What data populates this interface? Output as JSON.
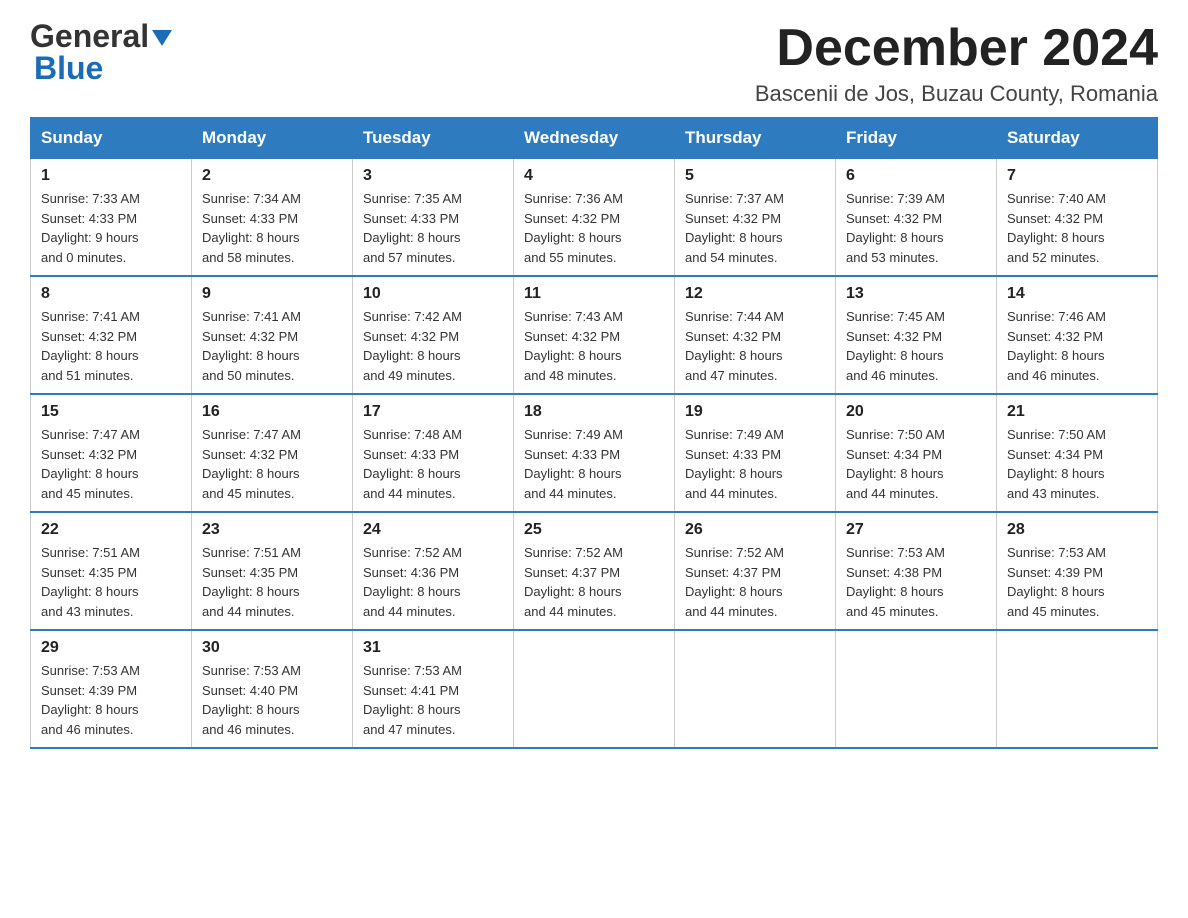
{
  "logo": {
    "general": "General",
    "blue": "Blue",
    "triangle": "▶"
  },
  "title": {
    "month_year": "December 2024",
    "location": "Bascenii de Jos, Buzau County, Romania"
  },
  "days_of_week": [
    "Sunday",
    "Monday",
    "Tuesday",
    "Wednesday",
    "Thursday",
    "Friday",
    "Saturday"
  ],
  "weeks": [
    [
      {
        "day": "1",
        "sunrise": "7:33 AM",
        "sunset": "4:33 PM",
        "daylight": "9 hours and 0 minutes."
      },
      {
        "day": "2",
        "sunrise": "7:34 AM",
        "sunset": "4:33 PM",
        "daylight": "8 hours and 58 minutes."
      },
      {
        "day": "3",
        "sunrise": "7:35 AM",
        "sunset": "4:33 PM",
        "daylight": "8 hours and 57 minutes."
      },
      {
        "day": "4",
        "sunrise": "7:36 AM",
        "sunset": "4:32 PM",
        "daylight": "8 hours and 55 minutes."
      },
      {
        "day": "5",
        "sunrise": "7:37 AM",
        "sunset": "4:32 PM",
        "daylight": "8 hours and 54 minutes."
      },
      {
        "day": "6",
        "sunrise": "7:39 AM",
        "sunset": "4:32 PM",
        "daylight": "8 hours and 53 minutes."
      },
      {
        "day": "7",
        "sunrise": "7:40 AM",
        "sunset": "4:32 PM",
        "daylight": "8 hours and 52 minutes."
      }
    ],
    [
      {
        "day": "8",
        "sunrise": "7:41 AM",
        "sunset": "4:32 PM",
        "daylight": "8 hours and 51 minutes."
      },
      {
        "day": "9",
        "sunrise": "7:41 AM",
        "sunset": "4:32 PM",
        "daylight": "8 hours and 50 minutes."
      },
      {
        "day": "10",
        "sunrise": "7:42 AM",
        "sunset": "4:32 PM",
        "daylight": "8 hours and 49 minutes."
      },
      {
        "day": "11",
        "sunrise": "7:43 AM",
        "sunset": "4:32 PM",
        "daylight": "8 hours and 48 minutes."
      },
      {
        "day": "12",
        "sunrise": "7:44 AM",
        "sunset": "4:32 PM",
        "daylight": "8 hours and 47 minutes."
      },
      {
        "day": "13",
        "sunrise": "7:45 AM",
        "sunset": "4:32 PM",
        "daylight": "8 hours and 46 minutes."
      },
      {
        "day": "14",
        "sunrise": "7:46 AM",
        "sunset": "4:32 PM",
        "daylight": "8 hours and 46 minutes."
      }
    ],
    [
      {
        "day": "15",
        "sunrise": "7:47 AM",
        "sunset": "4:32 PM",
        "daylight": "8 hours and 45 minutes."
      },
      {
        "day": "16",
        "sunrise": "7:47 AM",
        "sunset": "4:32 PM",
        "daylight": "8 hours and 45 minutes."
      },
      {
        "day": "17",
        "sunrise": "7:48 AM",
        "sunset": "4:33 PM",
        "daylight": "8 hours and 44 minutes."
      },
      {
        "day": "18",
        "sunrise": "7:49 AM",
        "sunset": "4:33 PM",
        "daylight": "8 hours and 44 minutes."
      },
      {
        "day": "19",
        "sunrise": "7:49 AM",
        "sunset": "4:33 PM",
        "daylight": "8 hours and 44 minutes."
      },
      {
        "day": "20",
        "sunrise": "7:50 AM",
        "sunset": "4:34 PM",
        "daylight": "8 hours and 44 minutes."
      },
      {
        "day": "21",
        "sunrise": "7:50 AM",
        "sunset": "4:34 PM",
        "daylight": "8 hours and 43 minutes."
      }
    ],
    [
      {
        "day": "22",
        "sunrise": "7:51 AM",
        "sunset": "4:35 PM",
        "daylight": "8 hours and 43 minutes."
      },
      {
        "day": "23",
        "sunrise": "7:51 AM",
        "sunset": "4:35 PM",
        "daylight": "8 hours and 44 minutes."
      },
      {
        "day": "24",
        "sunrise": "7:52 AM",
        "sunset": "4:36 PM",
        "daylight": "8 hours and 44 minutes."
      },
      {
        "day": "25",
        "sunrise": "7:52 AM",
        "sunset": "4:37 PM",
        "daylight": "8 hours and 44 minutes."
      },
      {
        "day": "26",
        "sunrise": "7:52 AM",
        "sunset": "4:37 PM",
        "daylight": "8 hours and 44 minutes."
      },
      {
        "day": "27",
        "sunrise": "7:53 AM",
        "sunset": "4:38 PM",
        "daylight": "8 hours and 45 minutes."
      },
      {
        "day": "28",
        "sunrise": "7:53 AM",
        "sunset": "4:39 PM",
        "daylight": "8 hours and 45 minutes."
      }
    ],
    [
      {
        "day": "29",
        "sunrise": "7:53 AM",
        "sunset": "4:39 PM",
        "daylight": "8 hours and 46 minutes."
      },
      {
        "day": "30",
        "sunrise": "7:53 AM",
        "sunset": "4:40 PM",
        "daylight": "8 hours and 46 minutes."
      },
      {
        "day": "31",
        "sunrise": "7:53 AM",
        "sunset": "4:41 PM",
        "daylight": "8 hours and 47 minutes."
      },
      null,
      null,
      null,
      null
    ]
  ],
  "labels": {
    "sunrise": "Sunrise:",
    "sunset": "Sunset:",
    "daylight": "Daylight:"
  }
}
